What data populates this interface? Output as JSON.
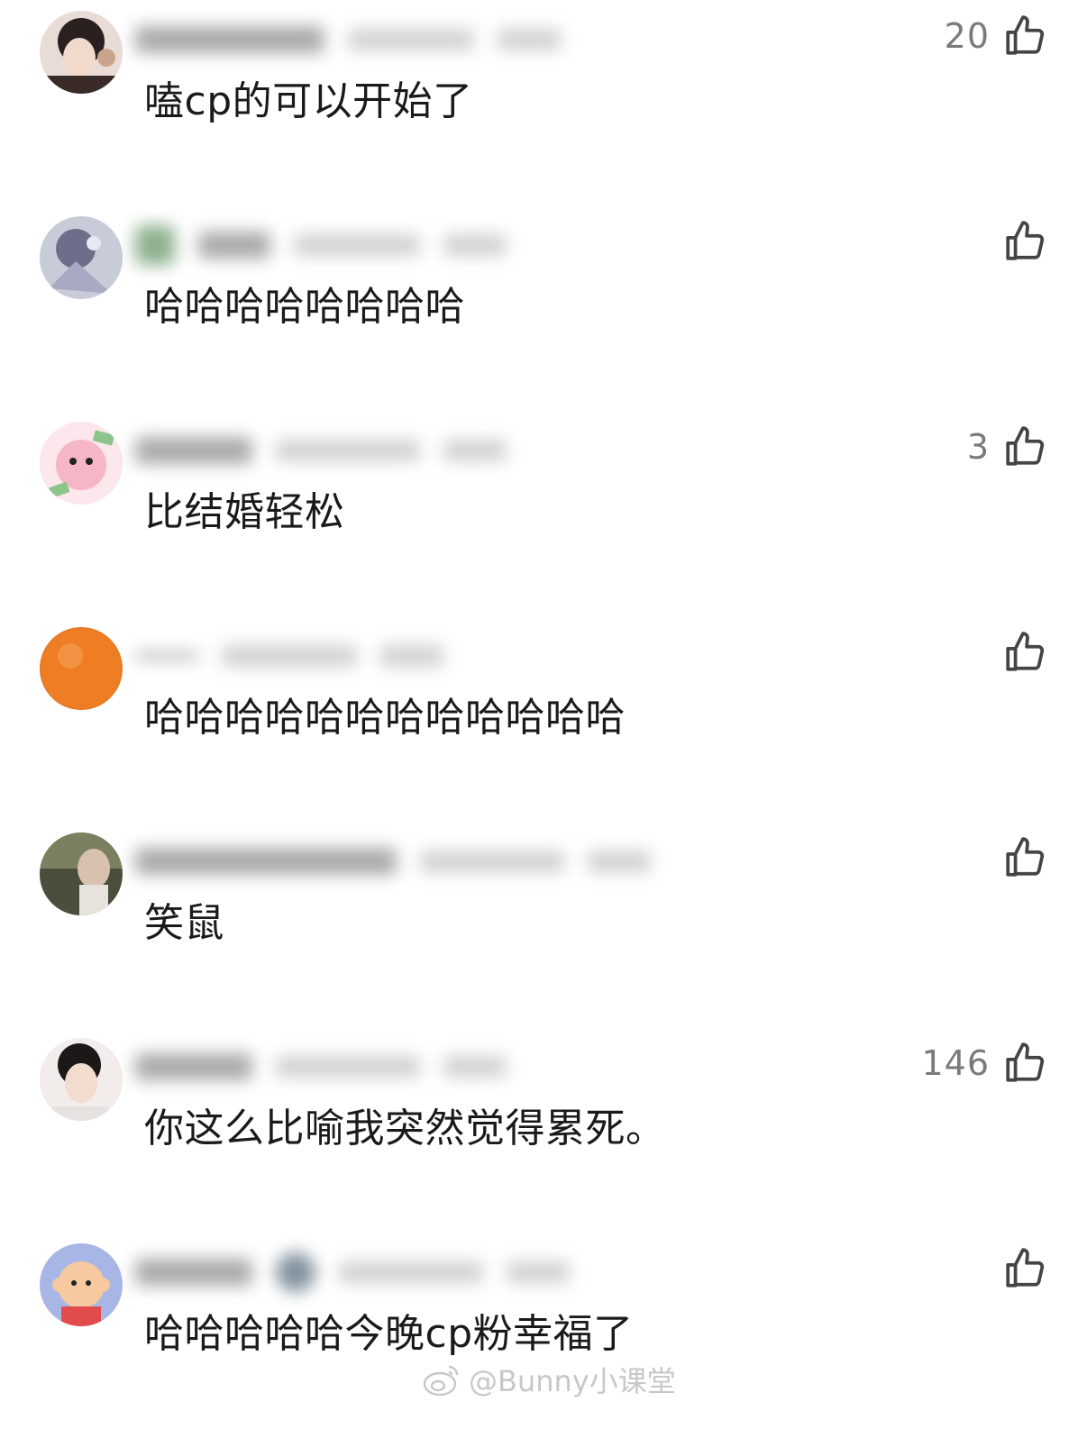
{
  "comments": [
    {
      "text": "嗑cp的可以开始了",
      "likes": "20"
    },
    {
      "text": "哈哈哈哈哈哈哈哈",
      "likes": ""
    },
    {
      "text": "比结婚轻松",
      "likes": "3"
    },
    {
      "text": "哈哈哈哈哈哈哈哈哈哈哈哈",
      "likes": ""
    },
    {
      "text": "笑鼠",
      "likes": ""
    },
    {
      "text": "你这么比喻我突然觉得累死。",
      "likes": "146"
    },
    {
      "text": "哈哈哈哈哈今晚cp粉幸福了",
      "likes": ""
    }
  ],
  "icons": {
    "like": "thumbs-up-icon",
    "watermark_logo": "weibo-logo-icon"
  },
  "watermark": {
    "text": "@Bunny小课堂"
  }
}
